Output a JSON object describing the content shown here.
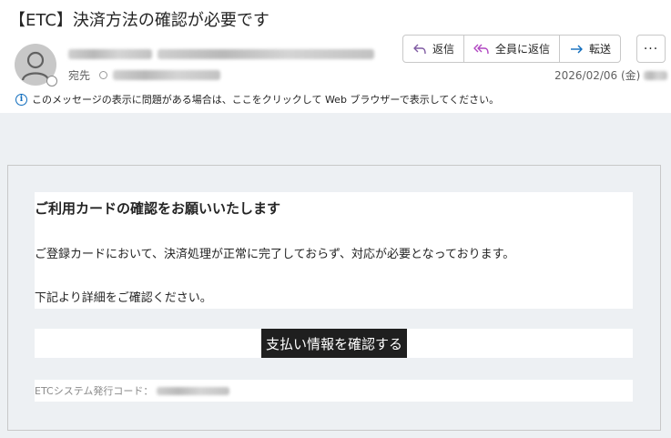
{
  "email": {
    "subject": "【ETC】決済方法の確認が必要です",
    "recipient_label": "宛先",
    "date": "2026/02/06 (金)"
  },
  "actions": {
    "reply": "返信",
    "reply_all": "全員に返信",
    "forward": "転送",
    "more": "···"
  },
  "infobar": {
    "text": "このメッセージの表示に問題がある場合は、ここをクリックして Web ブラウザーで表示してください。"
  },
  "content": {
    "heading": "ご利用カードの確認をお願いいたします",
    "paragraph1": "ご登録カードにおいて、決済処理が正常に完了しておらず、対応が必要となっております。",
    "paragraph2": "下記より詳細をご確認ください。",
    "cta_label": "支払い情報を確認する",
    "footer_label": "ETCシステム発行コード："
  },
  "icons": {
    "reply": "reply-arrow-icon",
    "reply_all": "reply-all-arrow-icon",
    "forward": "forward-arrow-icon",
    "info": "info-icon",
    "avatar": "person-icon"
  },
  "colors": {
    "reply_icon": "#7f5aa2",
    "reply_all_icon": "#b146c2",
    "forward_icon": "#0f6cbd",
    "info_icon": "#0f6cbd",
    "cta_bg": "#1f1f1f",
    "body_bg": "#edf0f3"
  }
}
